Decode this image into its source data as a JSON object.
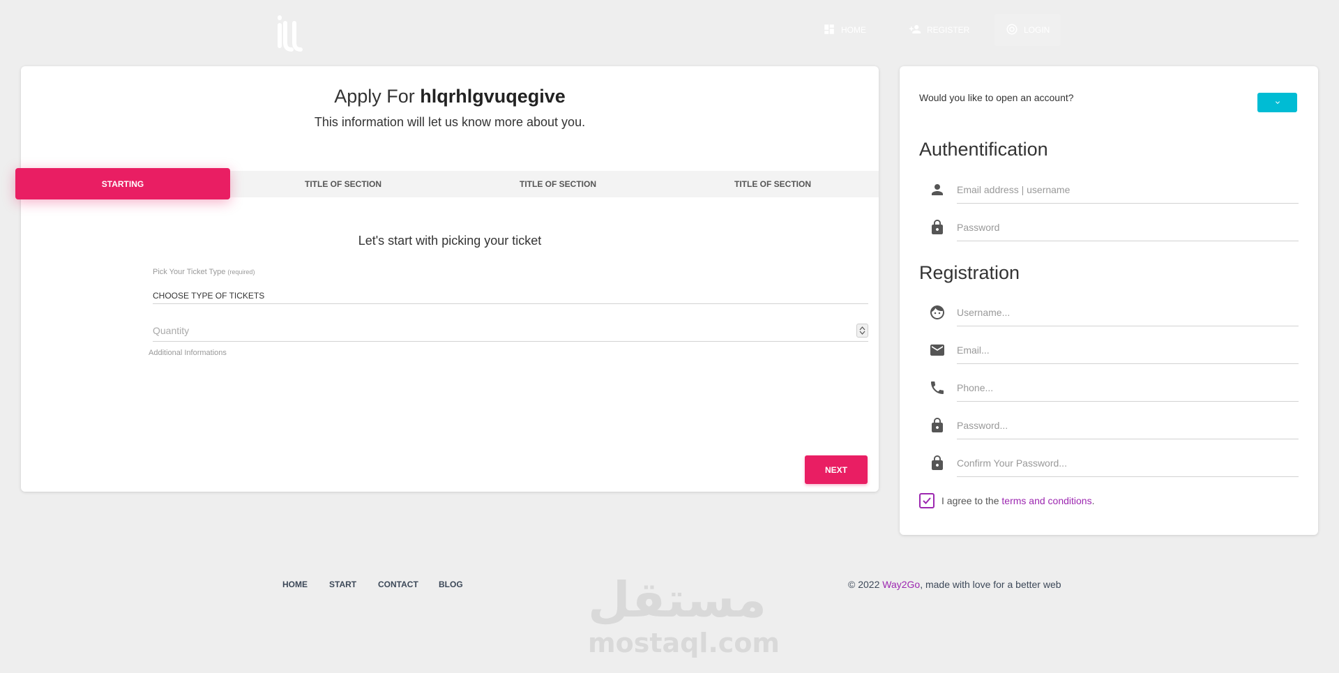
{
  "nav": {
    "home": "Home",
    "register": "Register",
    "login": "Login"
  },
  "wizard": {
    "title_prefix": "Apply For",
    "title_name": "hlqrhlgvuqegive",
    "subtitle": "This information will let us know more about you.",
    "tabs": [
      {
        "label": "Starting",
        "active": true
      },
      {
        "label": "Title of Section",
        "active": false
      },
      {
        "label": "Title of Section",
        "active": false
      },
      {
        "label": "Title of Section",
        "active": false
      }
    ],
    "step_heading": "Let's start with picking your ticket",
    "ticket_label": "Pick Your Ticket Type",
    "ticket_required": "(required)",
    "ticket_select_value": "Choose Type of Tickets",
    "quantity_placeholder": "Quantity",
    "additional_info": "Additional Informations",
    "next_label": "Next"
  },
  "auth": {
    "question": "Would you like to open an account?",
    "authentification_heading": "Authentification",
    "email_username_placeholder": "Email address | username",
    "password_placeholder": "Password",
    "registration_heading": "Registration",
    "username_placeholder": "Username...",
    "email_placeholder": "Email...",
    "phone_placeholder": "Phone...",
    "password2_placeholder": "Password...",
    "confirm_placeholder": "Confirm Your Password...",
    "terms_prefix": "I agree to the",
    "terms_link": "terms and conditions",
    "terms_suffix": ".",
    "terms_checked": true
  },
  "footer": {
    "links": [
      "Home",
      "Start",
      "Contact",
      "Blog"
    ],
    "copyright_prefix": "© 2022",
    "brand": "Way2Go",
    "copyright_suffix": ", made with love for a better web"
  },
  "watermark": {
    "arabic": "مستقل",
    "latin": "mostaql.com"
  },
  "colors": {
    "primary": "#e91e63",
    "info": "#00bcd4",
    "accent": "#9c27b0",
    "background": "#eeeeee"
  }
}
